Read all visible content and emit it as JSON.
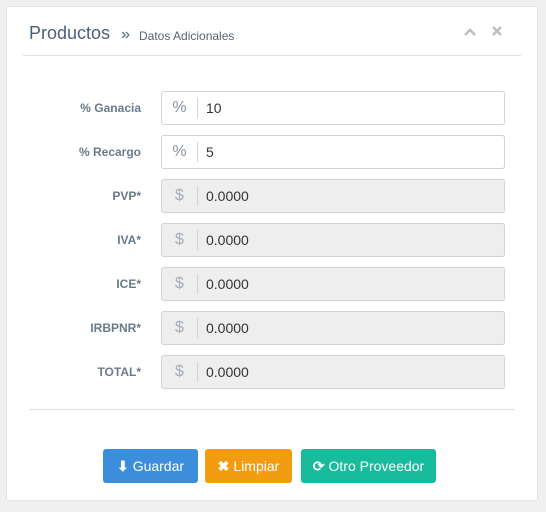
{
  "header": {
    "title": "Productos",
    "separator": "»",
    "subtitle": "Datos Adicionales",
    "collapse_icon": "chevron-up-icon",
    "close_icon": "close-icon"
  },
  "fields": [
    {
      "label": "% Ganacia",
      "icon": "percent",
      "symbol": "%",
      "value": "10",
      "readonly": false
    },
    {
      "label": "% Recargo",
      "icon": "percent",
      "symbol": "%",
      "value": "5",
      "readonly": false
    },
    {
      "label": "PVP*",
      "icon": "dollar",
      "symbol": "$",
      "value": "0.0000",
      "readonly": true
    },
    {
      "label": "IVA*",
      "icon": "dollar",
      "symbol": "$",
      "value": "0.0000",
      "readonly": true
    },
    {
      "label": "ICE*",
      "icon": "dollar",
      "symbol": "$",
      "value": "0.0000",
      "readonly": true
    },
    {
      "label": "IRBPNR*",
      "icon": "dollar",
      "symbol": "$",
      "value": "0.0000",
      "readonly": true
    },
    {
      "label": "TOTAL*",
      "icon": "dollar",
      "symbol": "$",
      "value": "0.0000",
      "readonly": true
    }
  ],
  "buttons": {
    "save": {
      "label": "Guardar",
      "icon": "download-icon",
      "glyph": "⬇",
      "color": "#3c8ddc"
    },
    "clear": {
      "label": "Limpiar",
      "icon": "times-icon",
      "glyph": "✖",
      "color": "#f39c12"
    },
    "provider": {
      "label": "Otro Proveedor",
      "icon": "refresh-icon",
      "glyph": "⟳",
      "color": "#18bc9c"
    }
  }
}
